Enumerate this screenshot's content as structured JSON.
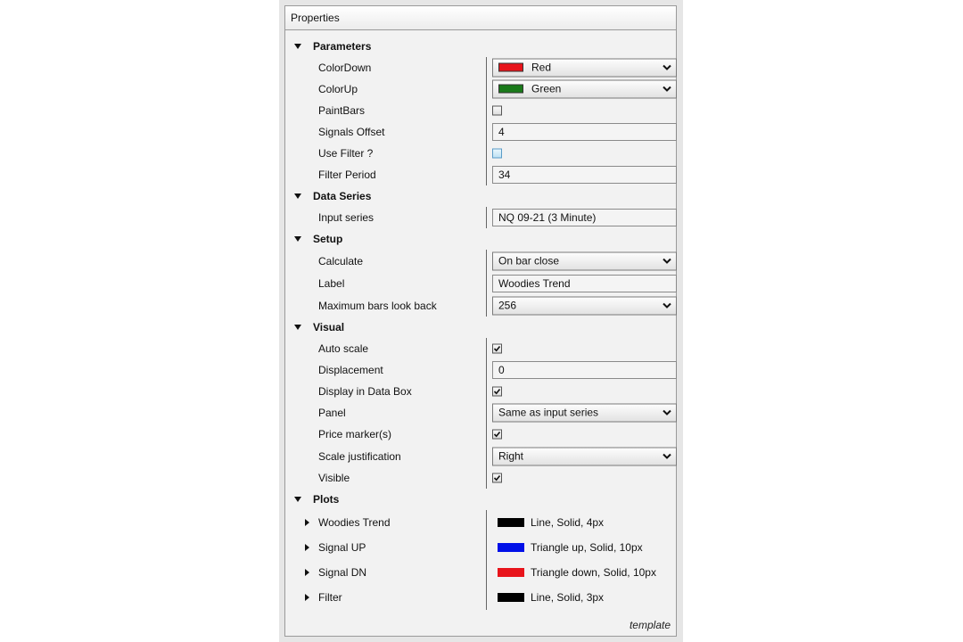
{
  "window": {
    "title": "Properties",
    "footer": "template"
  },
  "sections": {
    "parameters": "Parameters",
    "data_series": "Data Series",
    "setup": "Setup",
    "visual": "Visual",
    "plots": "Plots"
  },
  "parameters": {
    "color_down": {
      "label": "ColorDown",
      "value": "Red",
      "color": "#e8141b"
    },
    "color_up": {
      "label": "ColorUp",
      "value": "Green",
      "color": "#1a7a1a"
    },
    "paint_bars": {
      "label": "PaintBars",
      "checked": false
    },
    "signals_offset": {
      "label": "Signals Offset",
      "value": "4"
    },
    "use_filter": {
      "label": "Use Filter ?",
      "checked": false
    },
    "filter_period": {
      "label": "Filter Period",
      "value": "34"
    }
  },
  "data_series": {
    "input_series": {
      "label": "Input series",
      "value": "NQ 09-21 (3 Minute)"
    }
  },
  "setup": {
    "calculate": {
      "label": "Calculate",
      "value": "On bar close"
    },
    "label": {
      "label": "Label",
      "value": "Woodies Trend"
    },
    "max_bars": {
      "label": "Maximum bars look back",
      "value": "256"
    }
  },
  "visual": {
    "auto_scale": {
      "label": "Auto scale",
      "checked": true
    },
    "displacement": {
      "label": "Displacement",
      "value": "0"
    },
    "display_in_data_box": {
      "label": "Display in Data Box",
      "checked": true
    },
    "panel": {
      "label": "Panel",
      "value": "Same as input series"
    },
    "price_marker": {
      "label": "Price marker(s)",
      "checked": true
    },
    "scale_justification": {
      "label": "Scale justification",
      "value": "Right"
    },
    "visible": {
      "label": "Visible",
      "checked": true
    }
  },
  "plots": [
    {
      "label": "Woodies Trend",
      "value": "Line, Solid, 4px",
      "color": "#000000"
    },
    {
      "label": "Signal UP",
      "value": "Triangle up, Solid, 10px",
      "color": "#0010e8"
    },
    {
      "label": "Signal DN",
      "value": "Triangle down, Solid, 10px",
      "color": "#e8141b"
    },
    {
      "label": "Filter",
      "value": "Line, Solid, 3px",
      "color": "#000000"
    }
  ]
}
